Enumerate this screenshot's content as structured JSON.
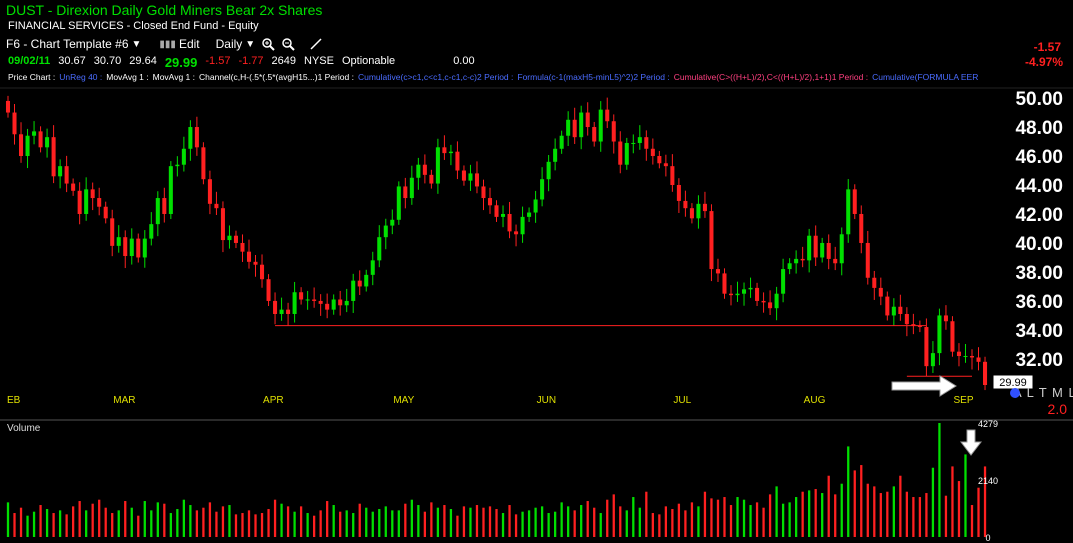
{
  "header": {
    "symbol_title": "DUST  -  Direxion Daily Gold Miners Bear 2x Shares",
    "sector": "FINANCIAL SERVICES - Closed End Fund - Equity"
  },
  "toolbar": {
    "template_label": "F6 - Chart Template #6",
    "edit_label": "Edit",
    "interval_label": "Daily",
    "template_dropdown_icon": "chevron-down-icon",
    "edit_icon": "bar-chart-icon",
    "zoom_in_icon": "zoom-in-icon",
    "zoom_out_icon": "zoom-out-icon",
    "draw_icon": "pen-icon"
  },
  "quote": {
    "date": "09/02/11",
    "open": "30.67",
    "high": "30.70",
    "low": "29.64",
    "last": "29.99",
    "change": "-1.57",
    "change_alt": "-1.77",
    "volume": "2649",
    "exchange": "NYSE",
    "optionable": "Optionable",
    "extra": "0.00",
    "change_right": "-1.57",
    "change_pct_right": "-4.97%"
  },
  "studies": [
    {
      "text": "Price Chart :",
      "color": "white"
    },
    {
      "text": "UnReg 40 :",
      "color": "blue"
    },
    {
      "text": "MovAvg 1 :",
      "color": "white"
    },
    {
      "text": "MovAvg 1 :",
      "color": "white"
    },
    {
      "text": "Channel(c,H-(.5*(.5*(avgH15...)1 Period :",
      "color": "white"
    },
    {
      "text": "Cumulative(c>c1,c<c1,c-c1,c-c)2 Period :",
      "color": "blue"
    },
    {
      "text": "Formula(c-1(maxH5-minL5)^2)2 Period :",
      "color": "blue"
    },
    {
      "text": "Cumulative(C>((H+L)/2),C<((H+L)/2),1+1)1 Period :",
      "color": "magenta"
    },
    {
      "text": "Cumulative(FORMULA EER",
      "color": "blue"
    }
  ],
  "price_label": "29.99",
  "watermark_letters": "A L T M L",
  "ratio_label": "2.0",
  "volume_label": "Volume",
  "colors": {
    "up": "#00e000",
    "down": "#ff2020",
    "support": "#ff2020",
    "axis_text": "#ffffff",
    "month_text": "#e0e000"
  },
  "chart_data": {
    "type": "candlestick",
    "title": "DUST Daily",
    "price_axis": {
      "min": 30.2,
      "max": 50.9,
      "ticks": [
        32,
        34,
        36,
        38,
        40,
        42,
        44,
        46,
        48,
        50
      ],
      "tick_labels": [
        "32.00",
        "34.00",
        "36.00",
        "38.00",
        "40.00",
        "42.00",
        "44.00",
        "46.00",
        "48.00",
        "50.00"
      ]
    },
    "volume_axis": {
      "max": 4279,
      "ticks": [
        0,
        2140,
        4279
      ],
      "tick_labels": [
        "0",
        "2140",
        "4279"
      ]
    },
    "x_months": [
      {
        "label": "EB",
        "start": -1
      },
      {
        "label": "MAR",
        "start": 18
      },
      {
        "label": "APR",
        "start": 41
      },
      {
        "label": "MAY",
        "start": 61
      },
      {
        "label": "JUN",
        "start": 83
      },
      {
        "label": "JUL",
        "start": 104
      },
      {
        "label": "AUG",
        "start": 124
      },
      {
        "label": "SEP",
        "start": 147
      }
    ],
    "total_bars": 149,
    "closes": [
      49.0,
      47.5,
      46.0,
      47.4,
      47.7,
      46.6,
      47.3,
      44.6,
      45.3,
      44.1,
      43.6,
      42.0,
      43.7,
      43.1,
      42.5,
      41.7,
      39.8,
      40.4,
      39.1,
      40.3,
      39.0,
      40.3,
      41.3,
      43.1,
      42.0,
      45.3,
      45.4,
      46.5,
      48.0,
      46.6,
      44.4,
      42.7,
      42.4,
      40.2,
      40.5,
      40.0,
      39.4,
      38.7,
      38.5,
      37.5,
      36.0,
      35.1,
      35.4,
      35.1,
      36.6,
      36.1,
      36.1,
      36.0,
      35.8,
      35.4,
      36.1,
      35.7,
      36.0,
      37.4,
      37.0,
      37.8,
      38.8,
      40.4,
      41.2,
      41.6,
      43.9,
      43.1,
      44.5,
      45.4,
      44.7,
      44.1,
      46.6,
      46.2,
      46.3,
      45.0,
      44.3,
      44.8,
      43.9,
      43.1,
      42.6,
      41.8,
      42.0,
      40.8,
      40.6,
      41.8,
      42.1,
      43.0,
      44.4,
      45.6,
      46.5,
      47.4,
      48.5,
      47.3,
      49.0,
      48.0,
      47.0,
      49.2,
      48.4,
      47.0,
      45.4,
      46.9,
      46.9,
      47.3,
      46.5,
      46.0,
      45.5,
      45.3,
      44.0,
      42.9,
      42.4,
      41.7,
      42.7,
      42.2,
      38.2,
      37.9,
      36.5,
      36.4,
      36.5,
      36.8,
      36.9,
      36.0,
      35.9,
      35.5,
      36.5,
      38.2,
      38.6,
      38.9,
      38.8,
      40.5,
      39.0,
      40.0,
      38.9,
      38.6,
      40.6,
      43.7,
      42.0,
      40.0,
      37.6,
      36.9,
      36.3,
      35.0,
      35.6,
      35.1,
      34.4,
      34.3,
      34.2,
      31.5,
      32.4,
      35.0,
      34.6,
      32.5,
      32.2,
      32.2,
      32.1,
      31.8,
      30.2
    ],
    "volumes": [
      1300,
      900,
      1100,
      800,
      950,
      1200,
      1050,
      900,
      1000,
      850,
      1150,
      1350,
      1000,
      1250,
      1400,
      1100,
      900,
      1000,
      1350,
      1100,
      800,
      1350,
      1000,
      1300,
      1250,
      900,
      1050,
      1400,
      1200,
      1000,
      1100,
      1300,
      950,
      1150,
      1200,
      850,
      900,
      1000,
      850,
      900,
      1050,
      1400,
      1250,
      1150,
      950,
      1150,
      900,
      800,
      1000,
      1350,
      1200,
      950,
      1000,
      900,
      1250,
      1100,
      950,
      1050,
      1150,
      1000,
      1000,
      1250,
      1400,
      1200,
      950,
      1300,
      1100,
      1200,
      1050,
      800,
      1150,
      1100,
      1200,
      1100,
      1150,
      1050,
      900,
      1200,
      850,
      950,
      1000,
      1100,
      1150,
      900,
      950,
      1300,
      1150,
      1000,
      1200,
      1350,
      1100,
      900,
      1400,
      1600,
      1150,
      1000,
      1500,
      1100,
      1700,
      900,
      850,
      1150,
      1050,
      1250,
      1000,
      1300,
      1150,
      1700,
      1450,
      1400,
      1500,
      1200,
      1500,
      1400,
      1200,
      1300,
      1100,
      1600,
      1900,
      1250,
      1300,
      1500,
      1700,
      1750,
      1800,
      1650,
      2300,
      1600,
      2000,
      3400,
      2500,
      2700,
      2000,
      1900,
      1650,
      1700,
      1900,
      2300,
      1700,
      1500,
      1500,
      1650,
      2600,
      4279,
      1550,
      2650,
      2100,
      3100,
      1200,
      1850,
      2649
    ],
    "support_lines": [
      {
        "from_bar": 41,
        "to_bar": 141,
        "price": 34.3
      },
      {
        "from_bar": 138,
        "to_bar": 148,
        "price": 30.8
      }
    ]
  }
}
